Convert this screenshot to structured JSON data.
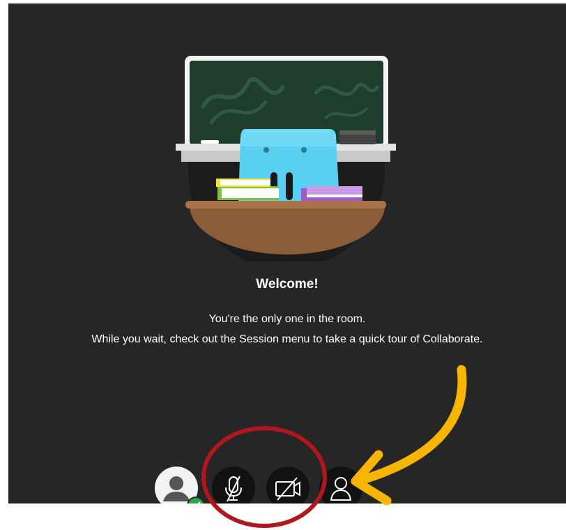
{
  "welcome": {
    "title": "Welcome!",
    "line1": "You're the only one in the room.",
    "line2": "While you wait, check out the Session menu to take a quick tour of Collaborate."
  },
  "controls": {
    "avatar_icon": "user-avatar-icon",
    "status_icon": "check-icon",
    "microphone_icon": "microphone-muted-icon",
    "camera_icon": "camera-off-icon",
    "share_icon": "share-content-icon"
  },
  "colors": {
    "background": "#262626",
    "control_background": "#111111",
    "status_green": "#2ea84a",
    "annotation_red": "#b0161b",
    "annotation_yellow": "#f7b500",
    "chalkboard": "#1e3d2c",
    "mascot_blue": "#5ad0f0",
    "desk_wood": "#8a5c38"
  }
}
